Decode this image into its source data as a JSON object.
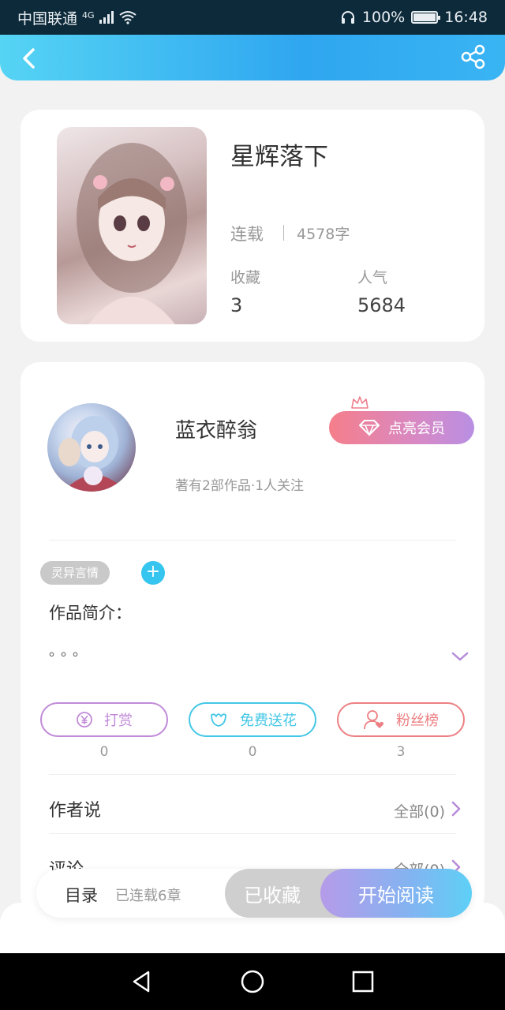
{
  "status_bar": {
    "carrier": "中国联通",
    "network": "4G",
    "battery": "100%",
    "time": "16:48"
  },
  "header": {
    "back_icon": "chevron-left-icon",
    "share_icon": "share-icon"
  },
  "book": {
    "title": "星辉落下",
    "status": "连载",
    "word_count": "4578字",
    "favorites_label": "收藏",
    "favorites_value": "3",
    "popularity_label": "人气",
    "popularity_value": "5684"
  },
  "author": {
    "name": "蓝衣醉翁",
    "meta": "著有2部作品·1人关注",
    "vip_button": "点亮会员"
  },
  "tags": {
    "genre": "灵异言情",
    "add": "+"
  },
  "intro": {
    "label": "作品简介：",
    "text": "。。。"
  },
  "actions": [
    {
      "label": "打赏",
      "count": "0",
      "color": "#c08ad8"
    },
    {
      "label": "免费送花",
      "count": "0",
      "color": "#44c7e6"
    },
    {
      "label": "粉丝榜",
      "count": "3",
      "color": "#ec7f82"
    }
  ],
  "author_says": {
    "title": "作者说",
    "more": "全部(0)"
  },
  "comments": {
    "title": "评论",
    "more": "全部(0)"
  },
  "bottom_bar": {
    "toc_label": "目录",
    "toc_info": "已连载6章",
    "fav_button": "已收藏",
    "read_button": "开始阅读"
  }
}
